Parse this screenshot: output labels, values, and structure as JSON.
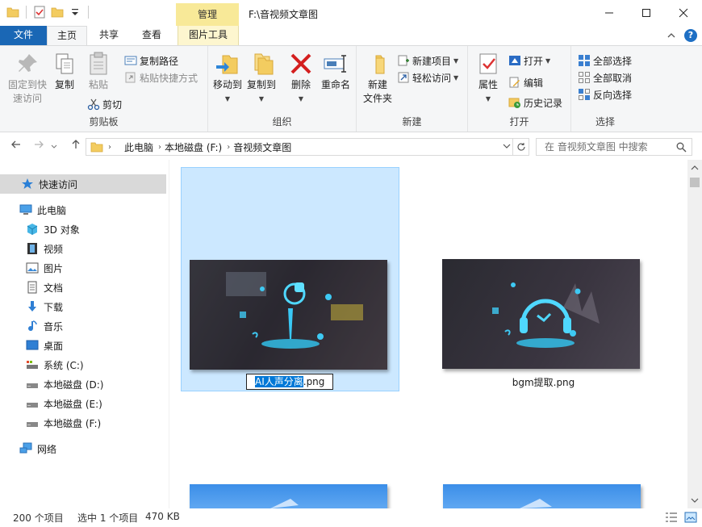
{
  "window": {
    "title": "F:\\音视频文章图",
    "manage_tab": "管理"
  },
  "tabs": {
    "file": "文件",
    "home": "主页",
    "share": "共享",
    "view": "查看",
    "picture_tools": "图片工具"
  },
  "ribbon": {
    "clipboard": {
      "label": "剪贴板",
      "pin": "固定到快\n速访问",
      "copy": "复制",
      "paste": "粘贴",
      "copy_path": "复制路径",
      "paste_shortcut": "粘贴快捷方式",
      "cut": "剪切"
    },
    "organize": {
      "label": "组织",
      "move_to": "移动到",
      "copy_to": "复制到",
      "delete": "删除",
      "rename": "重命名"
    },
    "new": {
      "label": "新建",
      "new_folder": "新建\n文件夹",
      "new_item": "新建项目",
      "easy_access": "轻松访问"
    },
    "open": {
      "label": "打开",
      "properties": "属性",
      "open": "打开",
      "edit": "编辑",
      "history": "历史记录"
    },
    "select": {
      "label": "选择",
      "select_all": "全部选择",
      "select_none": "全部取消",
      "invert": "反向选择"
    }
  },
  "address": {
    "crumbs": [
      "此电脑",
      "本地磁盘 (F:)",
      "音视频文章图"
    ],
    "search_placeholder": "在 音视频文章图 中搜索"
  },
  "nav": {
    "quick_access": "快速访问",
    "this_pc": "此电脑",
    "objects3d": "3D 对象",
    "videos": "视频",
    "pictures": "图片",
    "documents": "文档",
    "downloads": "下载",
    "music": "音乐",
    "desktop": "桌面",
    "drive_c": "系统 (C:)",
    "drive_d": "本地磁盘 (D:)",
    "drive_e": "本地磁盘 (E:)",
    "drive_f": "本地磁盘 (F:)",
    "network": "网络"
  },
  "files": {
    "file1_selected_part": "AI人声分离",
    "file1_ext": ".png",
    "file2": "bgm提取.png"
  },
  "status": {
    "count": "200 个项目",
    "selected": "选中 1 个项目",
    "size": "470 KB"
  },
  "colors": {
    "accent": "#1a67b5",
    "selection": "#cce8ff",
    "manage_tab": "#f8e998"
  }
}
